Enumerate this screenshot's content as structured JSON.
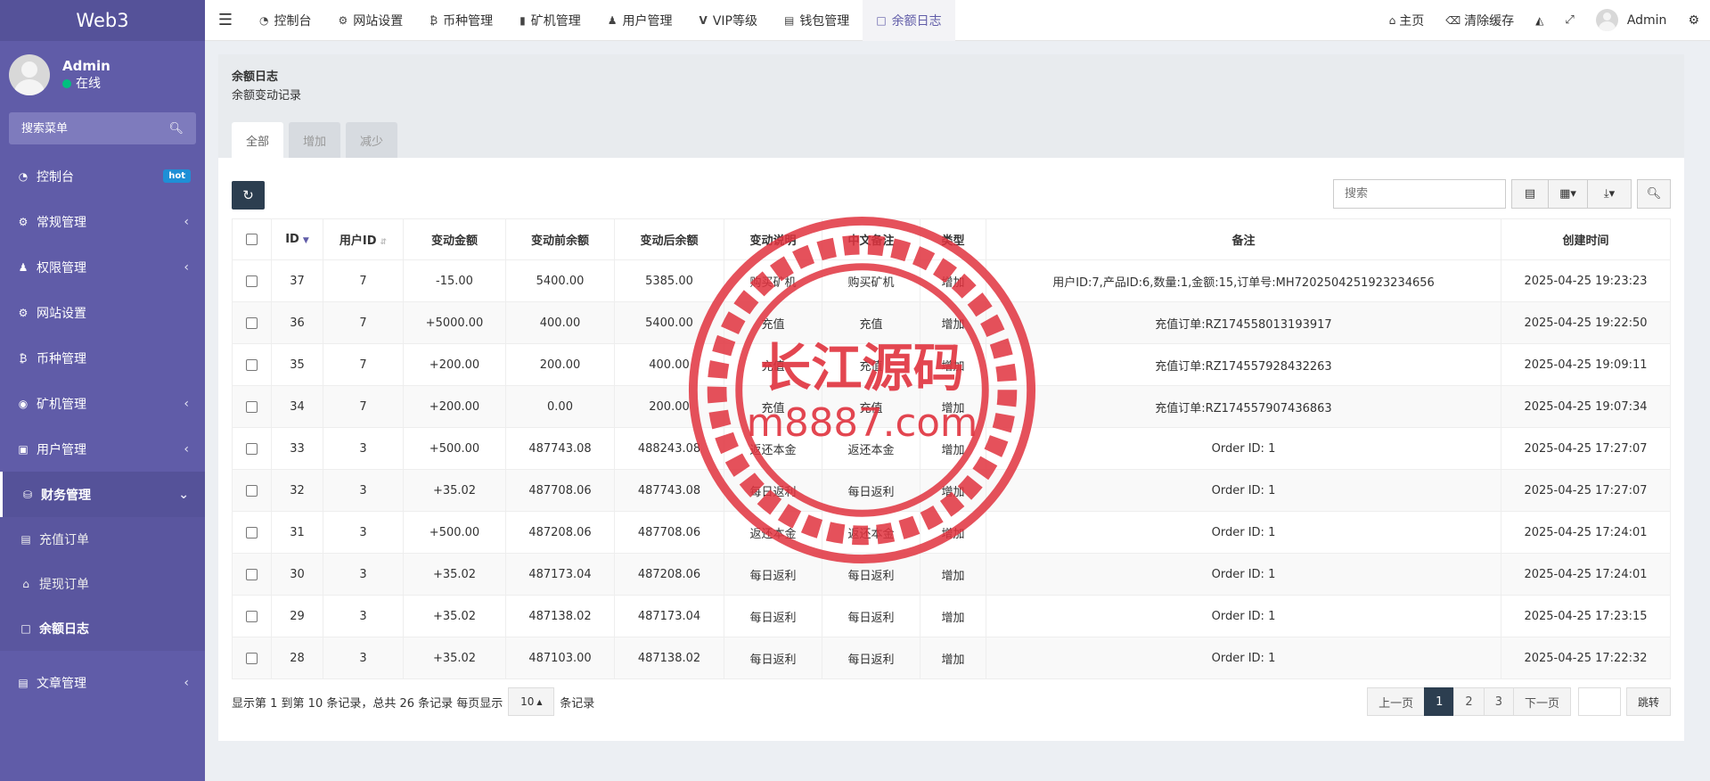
{
  "sidebar": {
    "brand": "Web3",
    "user": {
      "name": "Admin",
      "status": "在线"
    },
    "search_placeholder": "搜索菜单",
    "items": [
      {
        "label": "控制台",
        "icon": "dashboard-icon",
        "badge": "hot"
      },
      {
        "label": "常规管理",
        "icon": "cogs-icon"
      },
      {
        "label": "权限管理",
        "icon": "group-icon"
      },
      {
        "label": "网站设置",
        "icon": "cogs-icon"
      },
      {
        "label": "币种管理",
        "icon": "bitcoin-icon"
      },
      {
        "label": "矿机管理",
        "icon": "binoculars-icon"
      },
      {
        "label": "用户管理",
        "icon": "instagram-icon"
      },
      {
        "label": "财务管理",
        "icon": "database-icon"
      }
    ],
    "sub_items": [
      {
        "label": "充值订单",
        "icon": "money-icon"
      },
      {
        "label": "提现订单",
        "icon": "bank-icon"
      },
      {
        "label": "余额日志",
        "icon": "desktop-icon"
      }
    ],
    "after_item": {
      "label": "文章管理",
      "icon": "book-icon"
    }
  },
  "topnav": {
    "tabs": [
      {
        "label": "控制台",
        "icon": "dashboard-icon"
      },
      {
        "label": "网站设置",
        "icon": "cogs-icon"
      },
      {
        "label": "币种管理",
        "icon": "bitcoin-icon"
      },
      {
        "label": "矿机管理",
        "icon": "binoculars-icon"
      },
      {
        "label": "用户管理",
        "icon": "user-icon"
      },
      {
        "label": "VIP等级",
        "icon": "vimeo-icon"
      },
      {
        "label": "钱包管理",
        "icon": "credit-card-icon"
      },
      {
        "label": "余额日志",
        "icon": "desktop-icon"
      }
    ],
    "right": {
      "home": "主页",
      "clear_cache": "清除缓存",
      "user": "Admin"
    }
  },
  "panel": {
    "title": "余额日志",
    "subtitle": "余额变动记录",
    "tabs": [
      "全部",
      "增加",
      "减少"
    ],
    "search_placeholder": "搜索"
  },
  "table": {
    "headers": [
      "ID",
      "用户ID",
      "变动金额",
      "变动前余额",
      "变动后余额",
      "变动说明",
      "中文备注",
      "类型",
      "备注",
      "创建时间"
    ],
    "rows": [
      [
        "37",
        "7",
        "-15.00",
        "5400.00",
        "5385.00",
        "购买矿机",
        "购买矿机",
        "增加",
        "用户ID:7,产品ID:6,数量:1,金额:15,订单号:MH7202504251923234656",
        "2025-04-25 19:23:23"
      ],
      [
        "36",
        "7",
        "+5000.00",
        "400.00",
        "5400.00",
        "充值",
        "充值",
        "增加",
        "充值订单:RZ174558013193917",
        "2025-04-25 19:22:50"
      ],
      [
        "35",
        "7",
        "+200.00",
        "200.00",
        "400.00",
        "充值",
        "充值",
        "增加",
        "充值订单:RZ174557928432263",
        "2025-04-25 19:09:11"
      ],
      [
        "34",
        "7",
        "+200.00",
        "0.00",
        "200.00",
        "充值",
        "充值",
        "增加",
        "充值订单:RZ174557907436863",
        "2025-04-25 19:07:34"
      ],
      [
        "33",
        "3",
        "+500.00",
        "487743.08",
        "488243.08",
        "返还本金",
        "返还本金",
        "增加",
        "Order ID: 1",
        "2025-04-25 17:27:07"
      ],
      [
        "32",
        "3",
        "+35.02",
        "487708.06",
        "487743.08",
        "每日返利",
        "每日返利",
        "增加",
        "Order ID: 1",
        "2025-04-25 17:27:07"
      ],
      [
        "31",
        "3",
        "+500.00",
        "487208.06",
        "487708.06",
        "返还本金",
        "返还本金",
        "增加",
        "Order ID: 1",
        "2025-04-25 17:24:01"
      ],
      [
        "30",
        "3",
        "+35.02",
        "487173.04",
        "487208.06",
        "每日返利",
        "每日返利",
        "增加",
        "Order ID: 1",
        "2025-04-25 17:24:01"
      ],
      [
        "29",
        "3",
        "+35.02",
        "487138.02",
        "487173.04",
        "每日返利",
        "每日返利",
        "增加",
        "Order ID: 1",
        "2025-04-25 17:23:15"
      ],
      [
        "28",
        "3",
        "+35.02",
        "487103.00",
        "487138.02",
        "每日返利",
        "每日返利",
        "增加",
        "Order ID: 1",
        "2025-04-25 17:22:32"
      ]
    ]
  },
  "pager": {
    "info_before": "显示第 1 到第 10 条记录，总共 26 条记录 每页显示",
    "page_size": "10",
    "info_after": "条记录",
    "prev": "上一页",
    "pages": [
      "1",
      "2",
      "3"
    ],
    "next": "下一页",
    "go": "跳转"
  },
  "watermark": {
    "title": "长江源码",
    "url": "m8887.com"
  },
  "colors": {
    "sidebar": "#605ca8",
    "accent": "#605ca8",
    "positive": "#18bc9c",
    "negative": "#e74c3c",
    "dark_button": "#2c3e50",
    "watermark": "#e0323e"
  }
}
